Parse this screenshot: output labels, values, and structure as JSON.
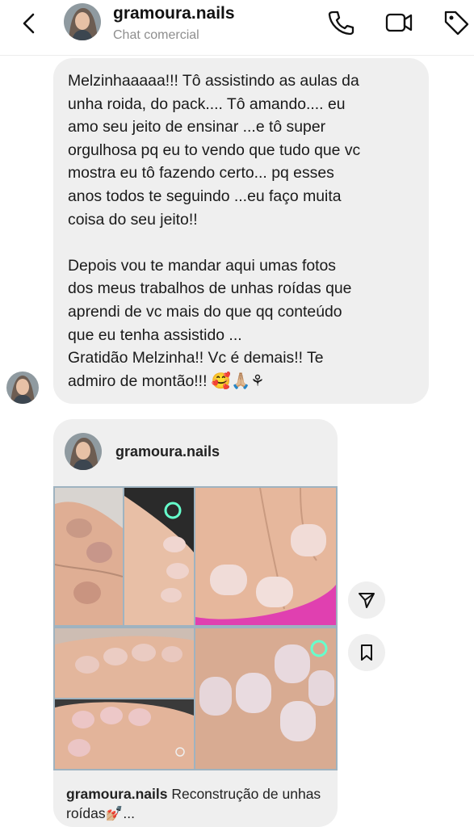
{
  "header": {
    "username": "gramoura.nails",
    "subtitle": "Chat comercial"
  },
  "message": {
    "text": "Melzinhaaaaa!!! Tô assistindo as aulas da\nunha roida, do pack.... Tô amando.... eu\namo seu jeito de ensinar ...e tô super\norgulhosa pq eu to vendo que tudo que vc\nmostra eu tô fazendo certo... pq esses\nanos todos te seguindo ...eu faço muita\ncoisa do seu jeito!!\n\nDepois vou te mandar aqui umas fotos\ndos meus trabalhos de unhas roídas que\naprendi de vc mais do que qq conteúdo\nque eu tenha assistido ...\nGratidão Melzinha!! Vc é demais!! Te\nadmiro de montão!!! 🥰🙏🏼⚘"
  },
  "shared_post": {
    "username": "gramoura.nails",
    "caption_user": "gramoura.nails",
    "caption_text": " Reconstrução de unhas roídas💅🏼..."
  },
  "colors": {
    "bubble": "#efefef",
    "muted_text": "#8e8e8e",
    "collage_bg": "#9fb3c0",
    "pink_mat": "#e040b0"
  },
  "icons": [
    "back-arrow-icon",
    "phone-icon",
    "video-camera-icon",
    "tag-icon",
    "send-icon",
    "bookmark-icon"
  ]
}
